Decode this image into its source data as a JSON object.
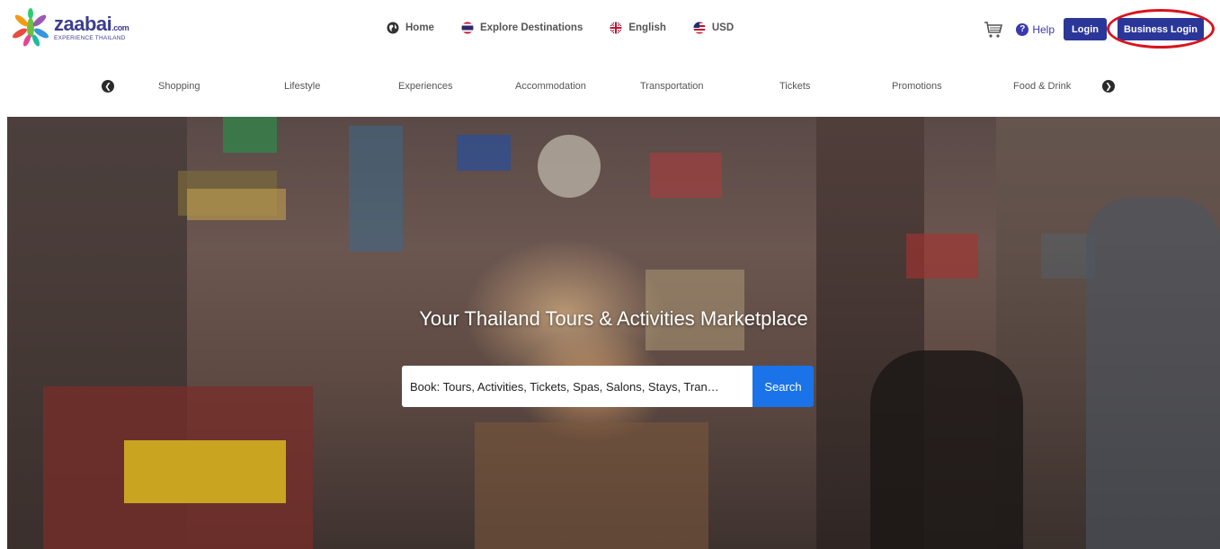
{
  "brand": {
    "name": "zaabai",
    "domain_suffix": ".com",
    "tagline": "EXPERIENCE THAILAND",
    "color": "#3d3d8f"
  },
  "topnav": {
    "items": [
      {
        "label": "Home",
        "icon": "globe-icon"
      },
      {
        "label": "Explore Destinations",
        "icon": "thailand-flag-icon"
      },
      {
        "label": "English",
        "icon": "uk-flag-icon"
      },
      {
        "label": "USD",
        "icon": "us-flag-icon"
      }
    ]
  },
  "rightnav": {
    "cart_icon": "cart-icon",
    "help_label": "Help",
    "login_label": "Login",
    "business_login_label": "Business Login",
    "button_color": "#2b3699",
    "highlight_color": "#d8141c"
  },
  "categories": [
    "Shopping",
    "Lifestyle",
    "Experiences",
    "Accommodation",
    "Transportation",
    "Tickets",
    "Promotions",
    "Food & Drink"
  ],
  "hero": {
    "title": "Your Thailand Tours & Activities Marketplace",
    "search_placeholder": "Book: Tours, Activities, Tickets, Spas, Salons, Stays, Tran…",
    "search_button": "Search",
    "search_button_color": "#1a73e8"
  }
}
